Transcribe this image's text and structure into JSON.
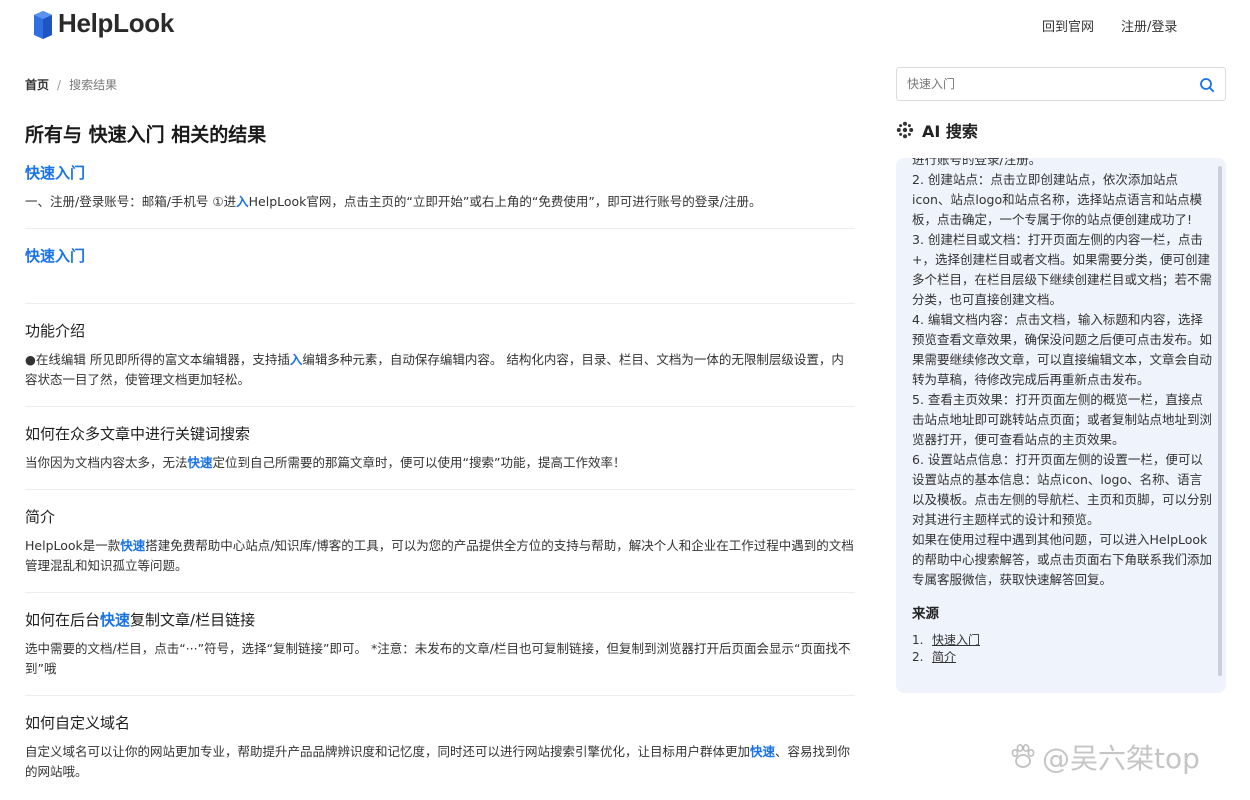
{
  "header": {
    "logo_text": "HelpLook",
    "nav": {
      "official": "回到官网",
      "login": "注册/登录"
    }
  },
  "breadcrumb": {
    "home": "首页",
    "separator": "/",
    "current": "搜索结果"
  },
  "page_title": "所有与 快速入门 相关的结果",
  "results": [
    {
      "title": "快速入门",
      "style": "blue",
      "snippet_parts": [
        "一、注册/登录账号：邮箱/手机号 ①进",
        "入",
        "HelpLook官网，点击主页的“立即开始”或右上角的“免费使用”，即可进行账号的登录/注册。"
      ]
    },
    {
      "title": "快速入门",
      "style": "blue",
      "snippet_parts": []
    },
    {
      "title": "功能介绍",
      "style": "plain",
      "snippet_parts": [
        "●在线编辑 所见即所得的富文本编辑器，支持插",
        "入",
        "编辑多种元素，自动保存编辑内容。 结构化内容，目录、栏目、文档为一体的无限制层级设置，内容状态一目了然，使管理文档更加轻松。"
      ]
    },
    {
      "title": "如何在众多文章中进行关键词搜索",
      "style": "plain",
      "snippet_parts": [
        "当你因为文档内容太多，无法",
        "快速",
        "定位到自己所需要的那篇文章时，便可以使用“搜索”功能，提高工作效率！"
      ]
    },
    {
      "title": "简介",
      "style": "plain",
      "snippet_parts": [
        "HelpLook是一款",
        "快速",
        "搭建免费帮助中心站点/知识库/博客的工具，可以为您的产品提供全方位的支持与帮助，解决个人和企业在工作过程中遇到的文档管理混乱和知识孤立等问题。"
      ]
    },
    {
      "title_parts": [
        "如何在后台",
        "快速",
        "复制文章/栏目链接"
      ],
      "style": "plain",
      "snippet_parts": [
        "选中需要的文档/栏目，点击“···”符号，选择“复制链接”即可。 *注意：未发布的文章/栏目也可复制链接，但复制到浏览器打开后页面会显示“页面找不到”哦"
      ]
    },
    {
      "title": "如何自定义域名",
      "style": "plain",
      "snippet_parts": [
        "自定义域名可以让你的网站更加专业，帮助提升产品品牌辨识度和记忆度，同时还可以进行网站搜索引擎优化，让目标用户群体更加",
        "快速",
        "、容易找到你的网站哦。"
      ]
    }
  ],
  "search": {
    "placeholder": "快速入门"
  },
  "ai": {
    "title": "AI 搜索",
    "paragraphs": [
      "进行账号的登录/注册。",
      "2. 创建站点：点击立即创建站点，依次添加站点icon、站点logo和站点名称，选择站点语言和站点模板，点击确定，一个专属于你的站点便创建成功了!",
      "3. 创建栏目或文档：打开页面左侧的内容一栏，点击+，选择创建栏目或者文档。如果需要分类，便可创建多个栏目，在栏目层级下继续创建栏目或文档；若不需分类，也可直接创建文档。",
      "4. 编辑文档内容：点击文档，输入标题和内容，选择预览查看文章效果，确保没问题之后便可点击发布。如果需要继续修改文章，可以直接编辑文本，文章会自动转为草稿，待修改完成后再重新点击发布。",
      "5. 查看主页效果：打开页面左侧的概览一栏，直接点击站点地址即可跳转站点页面；或者复制站点地址到浏览器打开，便可查看站点的主页效果。",
      "6. 设置站点信息：打开页面左侧的设置一栏，便可以设置站点的基本信息：站点icon、logo、名称、语言以及模板。点击左侧的导航栏、主页和页脚，可以分别对其进行主题样式的设计和预览。",
      "如果在使用过程中遇到其他问题，可以进入HelpLook的帮助中心搜索解答，或点击页面右下角联系我们添加专属客服微信，获取快速解答回复。"
    ],
    "sources_title": "来源",
    "sources": [
      {
        "num": "1.",
        "label": "快速入门"
      },
      {
        "num": "2.",
        "label": "简介"
      }
    ]
  },
  "watermark": "@吴六桀top",
  "colors": {
    "accent": "#1a73e8",
    "ai_panel_bg": "#eff3fb",
    "logo_blue": "#2f6fe0"
  }
}
